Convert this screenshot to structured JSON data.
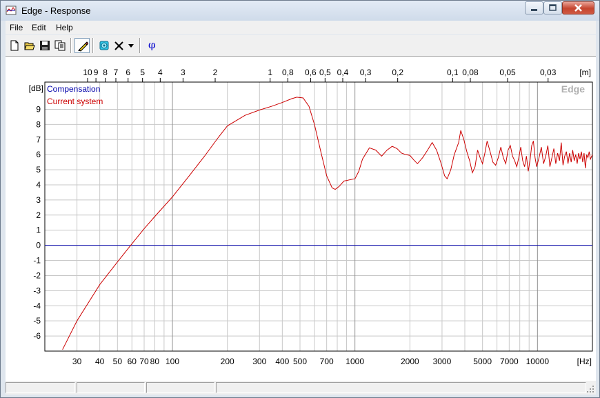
{
  "window": {
    "title": "Edge - Response"
  },
  "menu": [
    {
      "label": "File"
    },
    {
      "label": "Edit"
    },
    {
      "label": "Help"
    }
  ],
  "toolbar": {
    "icons": [
      "new-file-icon",
      "open-folder-icon",
      "save-icon",
      "copy-icon",
      "pencil-icon",
      "loudspeaker-icon",
      "delete-icon",
      "dropdown-arrow-icon",
      "phase-icon"
    ],
    "phase_label": "φ"
  },
  "colors": {
    "compensation": "#0000aa",
    "current_system": "#cc0000",
    "grid_major": "#909090",
    "grid_minor": "#c8c8c8",
    "watermark": "#b0b0b0"
  },
  "chart_data": {
    "type": "line",
    "watermark": "Edge",
    "ylabel": "[dB]",
    "x_unit": "[Hz]",
    "top_unit": "[m]",
    "x_scale": "log",
    "xlim": [
      20,
      20000
    ],
    "ylim": [
      -7,
      10.8
    ],
    "legend_position": "top-left",
    "x_ticks": [
      {
        "v": 30,
        "l": "30"
      },
      {
        "v": 40,
        "l": "40"
      },
      {
        "v": 50,
        "l": "50"
      },
      {
        "v": 60,
        "l": "60"
      },
      {
        "v": 70,
        "l": "70"
      },
      {
        "v": 80,
        "l": "80"
      },
      {
        "v": 100,
        "l": "100"
      },
      {
        "v": 200,
        "l": "200"
      },
      {
        "v": 300,
        "l": "300"
      },
      {
        "v": 400,
        "l": "400"
      },
      {
        "v": 500,
        "l": "500"
      },
      {
        "v": 700,
        "l": "700"
      },
      {
        "v": 1000,
        "l": "1000"
      },
      {
        "v": 2000,
        "l": "2000"
      },
      {
        "v": 3000,
        "l": "3000"
      },
      {
        "v": 5000,
        "l": "5000"
      },
      {
        "v": 7000,
        "l": "7000"
      },
      {
        "v": 10000,
        "l": "10000"
      }
    ],
    "x_major_lines": [
      100,
      1000,
      10000
    ],
    "x_minor_lines": [
      30,
      40,
      50,
      60,
      70,
      80,
      90,
      200,
      300,
      400,
      500,
      600,
      700,
      800,
      900,
      2000,
      3000,
      4000,
      5000,
      6000,
      7000,
      8000,
      9000
    ],
    "top_ticks": [
      {
        "v": 10,
        "l": "10"
      },
      {
        "v": 9,
        "l": "9"
      },
      {
        "v": 8,
        "l": "8"
      },
      {
        "v": 7,
        "l": "7"
      },
      {
        "v": 6,
        "l": "6"
      },
      {
        "v": 5,
        "l": "5"
      },
      {
        "v": 4,
        "l": "4"
      },
      {
        "v": 3,
        "l": "3"
      },
      {
        "v": 2,
        "l": "2"
      },
      {
        "v": 1,
        "l": "1"
      },
      {
        "v": 0.8,
        "l": "0,8"
      },
      {
        "v": 0.6,
        "l": "0,6"
      },
      {
        "v": 0.5,
        "l": "0,5"
      },
      {
        "v": 0.4,
        "l": "0,4"
      },
      {
        "v": 0.3,
        "l": "0,3"
      },
      {
        "v": 0.2,
        "l": "0,2"
      },
      {
        "v": 0.1,
        "l": "0,1"
      },
      {
        "v": 0.08,
        "l": "0,08"
      },
      {
        "v": 0.05,
        "l": "0,05"
      },
      {
        "v": 0.03,
        "l": "0,03"
      }
    ],
    "y_ticks": [
      9,
      8,
      7,
      6,
      5,
      4,
      3,
      2,
      1,
      0,
      -1,
      -2,
      -3,
      -4,
      -5,
      -6
    ],
    "series": [
      {
        "name": "Compensation",
        "color_key": "compensation",
        "points": [
          [
            20,
            0
          ],
          [
            20000,
            0
          ]
        ]
      },
      {
        "name": "Current system",
        "color_key": "current_system",
        "points": [
          [
            25,
            -6.9
          ],
          [
            30,
            -5.0
          ],
          [
            40,
            -2.6
          ],
          [
            50,
            -1.1
          ],
          [
            60,
            0.1
          ],
          [
            70,
            1.1
          ],
          [
            80,
            1.9
          ],
          [
            100,
            3.2
          ],
          [
            120,
            4.4
          ],
          [
            150,
            5.9
          ],
          [
            180,
            7.2
          ],
          [
            200,
            7.9
          ],
          [
            250,
            8.6
          ],
          [
            300,
            8.95
          ],
          [
            350,
            9.2
          ],
          [
            400,
            9.45
          ],
          [
            450,
            9.7
          ],
          [
            480,
            9.8
          ],
          [
            520,
            9.75
          ],
          [
            560,
            9.2
          ],
          [
            600,
            8.0
          ],
          [
            650,
            6.2
          ],
          [
            700,
            4.6
          ],
          [
            750,
            3.8
          ],
          [
            780,
            3.7
          ],
          [
            820,
            3.9
          ],
          [
            870,
            4.25
          ],
          [
            950,
            4.35
          ],
          [
            1000,
            4.4
          ],
          [
            1050,
            4.9
          ],
          [
            1100,
            5.7
          ],
          [
            1200,
            6.45
          ],
          [
            1300,
            6.3
          ],
          [
            1400,
            5.9
          ],
          [
            1500,
            6.3
          ],
          [
            1600,
            6.55
          ],
          [
            1700,
            6.4
          ],
          [
            1800,
            6.1
          ],
          [
            1900,
            6.0
          ],
          [
            2000,
            5.95
          ],
          [
            2100,
            5.65
          ],
          [
            2200,
            5.4
          ],
          [
            2350,
            5.8
          ],
          [
            2500,
            6.3
          ],
          [
            2650,
            6.8
          ],
          [
            2800,
            6.3
          ],
          [
            2950,
            5.5
          ],
          [
            3100,
            4.6
          ],
          [
            3200,
            4.4
          ],
          [
            3350,
            5.0
          ],
          [
            3500,
            6.0
          ],
          [
            3700,
            6.8
          ],
          [
            3800,
            7.6
          ],
          [
            3950,
            7.0
          ],
          [
            4100,
            6.2
          ],
          [
            4250,
            5.6
          ],
          [
            4400,
            4.8
          ],
          [
            4550,
            5.2
          ],
          [
            4700,
            6.3
          ],
          [
            4850,
            5.8
          ],
          [
            5000,
            5.4
          ],
          [
            5150,
            6.1
          ],
          [
            5300,
            6.9
          ],
          [
            5500,
            6.2
          ],
          [
            5700,
            5.5
          ],
          [
            5900,
            5.3
          ],
          [
            6100,
            5.8
          ],
          [
            6300,
            6.5
          ],
          [
            6500,
            5.8
          ],
          [
            6700,
            5.4
          ],
          [
            6900,
            6.3
          ],
          [
            7100,
            6.6
          ],
          [
            7300,
            5.9
          ],
          [
            7500,
            5.6
          ],
          [
            7700,
            5.2
          ],
          [
            7900,
            5.8
          ],
          [
            8100,
            6.5
          ],
          [
            8300,
            5.6
          ],
          [
            8500,
            5.2
          ],
          [
            8700,
            5.9
          ],
          [
            8900,
            4.9
          ],
          [
            9100,
            5.6
          ],
          [
            9300,
            6.6
          ],
          [
            9500,
            6.9
          ],
          [
            9700,
            5.8
          ],
          [
            9900,
            5.2
          ],
          [
            10200,
            5.8
          ],
          [
            10500,
            6.5
          ],
          [
            10800,
            5.4
          ],
          [
            11100,
            5.9
          ],
          [
            11400,
            6.6
          ],
          [
            11700,
            5.2
          ],
          [
            12000,
            5.8
          ],
          [
            12300,
            6.4
          ],
          [
            12600,
            5.4
          ],
          [
            12900,
            6.1
          ],
          [
            13200,
            5.6
          ],
          [
            13500,
            6.8
          ],
          [
            13800,
            5.3
          ],
          [
            14100,
            5.9
          ],
          [
            14400,
            6.2
          ],
          [
            14700,
            5.4
          ],
          [
            15000,
            6.1
          ],
          [
            15300,
            5.5
          ],
          [
            15600,
            6.3
          ],
          [
            15900,
            5.6
          ],
          [
            16200,
            6.0
          ],
          [
            16500,
            5.4
          ],
          [
            16800,
            6.1
          ],
          [
            17100,
            5.7
          ],
          [
            17400,
            6.2
          ],
          [
            17700,
            5.5
          ],
          [
            18000,
            6.1
          ],
          [
            18300,
            5.1
          ],
          [
            18600,
            6.0
          ],
          [
            18900,
            5.8
          ],
          [
            19200,
            6.2
          ],
          [
            19500,
            5.7
          ],
          [
            20000,
            6.0
          ]
        ]
      }
    ]
  }
}
